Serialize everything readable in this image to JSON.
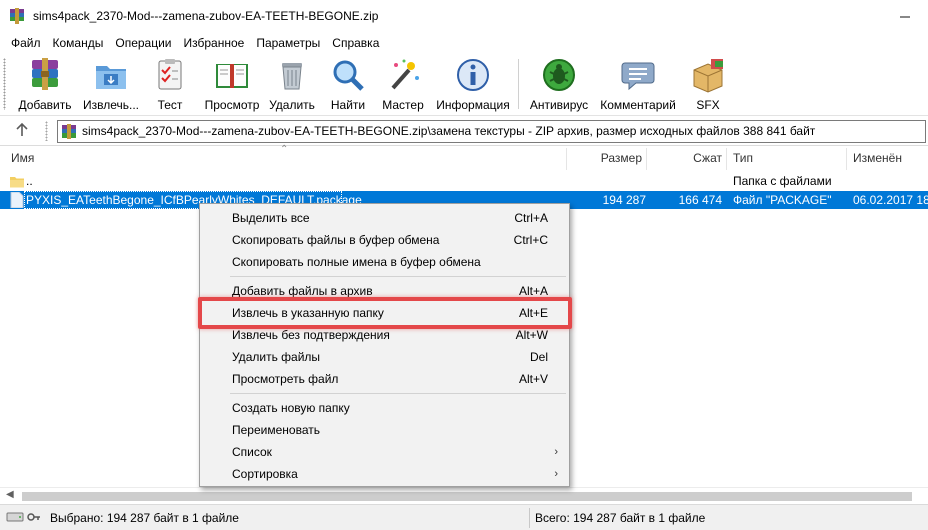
{
  "window": {
    "title": "sims4pack_2370-Mod---zamena-zubov-EA-TEETH-BEGONE.zip"
  },
  "menu": [
    "Файл",
    "Команды",
    "Операции",
    "Избранное",
    "Параметры",
    "Справка"
  ],
  "toolbar": {
    "add": "Добавить",
    "extract": "Извлечь...",
    "test": "Тест",
    "view": "Просмотр",
    "delete": "Удалить",
    "find": "Найти",
    "wizard": "Мастер",
    "info": "Информация",
    "antivirus": "Антивирус",
    "comment": "Комментарий",
    "sfx": "SFX"
  },
  "address": {
    "path": "sims4pack_2370-Mod---zamena-zubov-EA-TEETH-BEGONE.zip\\замена текстуры - ZIP архив, размер исходных файлов 388 841 байт"
  },
  "columns": {
    "name": "Имя",
    "size": "Размер",
    "packed": "Сжат",
    "type": "Тип",
    "modified": "Изменён"
  },
  "files": [
    {
      "name": "..",
      "size": "",
      "packed": "",
      "type": "Папка с файлами",
      "modified": ""
    },
    {
      "name": "PYXIS_EATeethBegone_ICfBPearlyWhites_DEFAULT.package",
      "size": "194 287",
      "packed": "166 474",
      "type": "Файл \"PACKAGE\"",
      "modified": "06.02.2017 18:"
    }
  ],
  "context_menu": {
    "select_all": {
      "label": "Выделить все",
      "key": "Ctrl+A"
    },
    "copy_files": {
      "label": "Скопировать файлы в буфер обмена",
      "key": "Ctrl+C"
    },
    "copy_names": {
      "label": "Скопировать полные имена в буфер обмена",
      "key": ""
    },
    "add_to_archive": {
      "label": "Добавить файлы в архив",
      "key": "Alt+A"
    },
    "extract_to_folder": {
      "label": "Извлечь в указанную папку",
      "key": "Alt+E"
    },
    "extract_no_confirm": {
      "label": "Извлечь без подтверждения",
      "key": "Alt+W"
    },
    "delete_files": {
      "label": "Удалить файлы",
      "key": "Del"
    },
    "view_file": {
      "label": "Просмотреть файл",
      "key": "Alt+V"
    },
    "new_folder": {
      "label": "Создать новую папку",
      "key": ""
    },
    "rename": {
      "label": "Переименовать",
      "key": ""
    },
    "list": {
      "label": "Список",
      "key": ""
    },
    "sort": {
      "label": "Сортировка",
      "key": ""
    }
  },
  "status": {
    "selected": "Выбрано: 194 287 байт в 1 файле",
    "total": "Всего: 194 287 байт в 1 файле"
  },
  "colors": {
    "selection": "#0078d7",
    "highlight_annotation": "#e4484a"
  }
}
